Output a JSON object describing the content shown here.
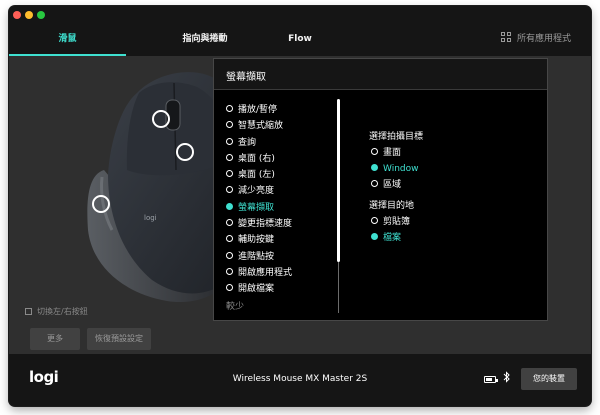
{
  "tabs": [
    {
      "label": "滑鼠",
      "active": true
    },
    {
      "label": "指向與捲動",
      "active": false
    },
    {
      "label": "Flow",
      "active": false
    }
  ],
  "all_apps": {
    "label": "所有應用程式",
    "icon": "grid-icon"
  },
  "colors": {
    "accent": "#3fe0d0",
    "background": "#2f2f2f",
    "bar": "#151515",
    "panel": "#000000"
  },
  "left_panel": {
    "swap_buttons_label": "切換左/右按鈕",
    "swap_buttons_checked": false,
    "more_button": "更多",
    "restore_defaults_button": "恢復預設設定"
  },
  "action_panel": {
    "title": "螢幕擷取",
    "actions": [
      {
        "label": "播放/暫停",
        "selected": false
      },
      {
        "label": "智慧式縮放",
        "selected": false
      },
      {
        "label": "查詢",
        "selected": false
      },
      {
        "label": "桌面 (右)",
        "selected": false
      },
      {
        "label": "桌面 (左)",
        "selected": false
      },
      {
        "label": "減少亮度",
        "selected": false
      },
      {
        "label": "螢幕擷取",
        "selected": true
      },
      {
        "label": "變更指標速度",
        "selected": false
      },
      {
        "label": "輔助按鍵",
        "selected": false
      },
      {
        "label": "進階點按",
        "selected": false
      },
      {
        "label": "開啟應用程式",
        "selected": false
      },
      {
        "label": "開啟檔案",
        "selected": false
      }
    ],
    "less_label": "較少",
    "scroll_position": 0.0,
    "options": {
      "capture_target": {
        "title": "選擇拍攝目標",
        "items": [
          {
            "label": "畫面",
            "selected": false
          },
          {
            "label": "Window",
            "selected": true
          },
          {
            "label": "區域",
            "selected": false
          }
        ]
      },
      "destination": {
        "title": "選擇目的地",
        "items": [
          {
            "label": "剪貼簿",
            "selected": false
          },
          {
            "label": "檔案",
            "selected": true
          }
        ]
      }
    }
  },
  "footer": {
    "logo": "logi",
    "device_name": "Wireless Mouse MX Master 2S",
    "battery_level": 0.6,
    "bluetooth_icon": "bluetooth-icon",
    "my_devices_button": "您的裝置"
  }
}
